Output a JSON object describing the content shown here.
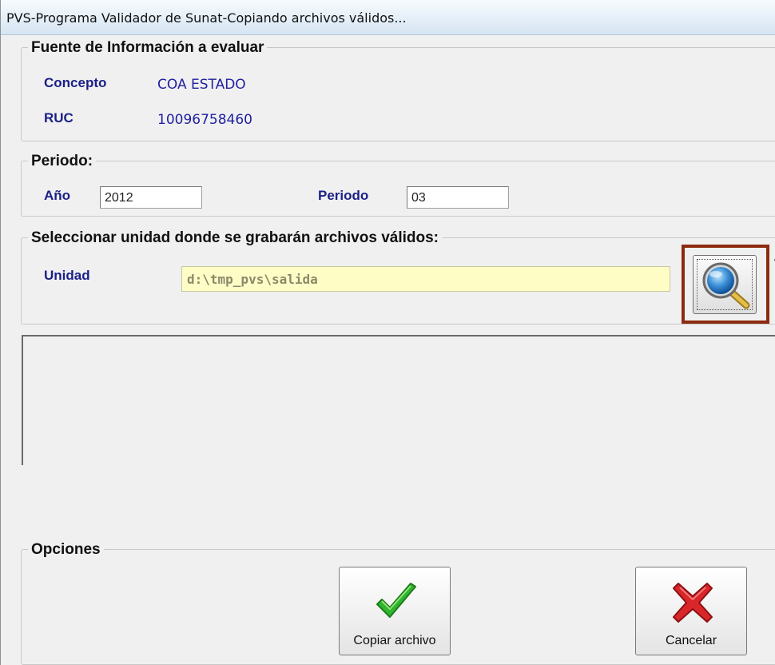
{
  "window": {
    "title": "PVS-Programa Validador de Sunat-Copiando archivos válidos..."
  },
  "source_group": {
    "legend": "Fuente de Información a evaluar",
    "concepto_label": "Concepto",
    "concepto_value": "COA ESTADO",
    "ruc_label": "RUC",
    "ruc_value": "10096758460"
  },
  "period_group": {
    "legend": "Periodo:",
    "year_label": "Año",
    "year_value": "2012",
    "period_label": "Periodo",
    "period_value": "03"
  },
  "unit_group": {
    "legend": "Seleccionar unidad donde se grabarán archivos válidos:",
    "unit_label": "Unidad",
    "unit_value": "d:\\tmp_pvs\\salida"
  },
  "options_group": {
    "legend": "Opciones",
    "copy_label": "Copiar archivo",
    "cancel_label": "Cancelar"
  },
  "colors": {
    "label_blue": "#1a1f86",
    "highlight_border": "#8b2b0f",
    "unit_field_bg": "#fffdc6",
    "check_green": "#2fb52f",
    "cross_red": "#d8262a"
  },
  "icons": {
    "browse": "magnifier-icon",
    "copy": "green-check-icon",
    "cancel": "red-x-icon"
  }
}
